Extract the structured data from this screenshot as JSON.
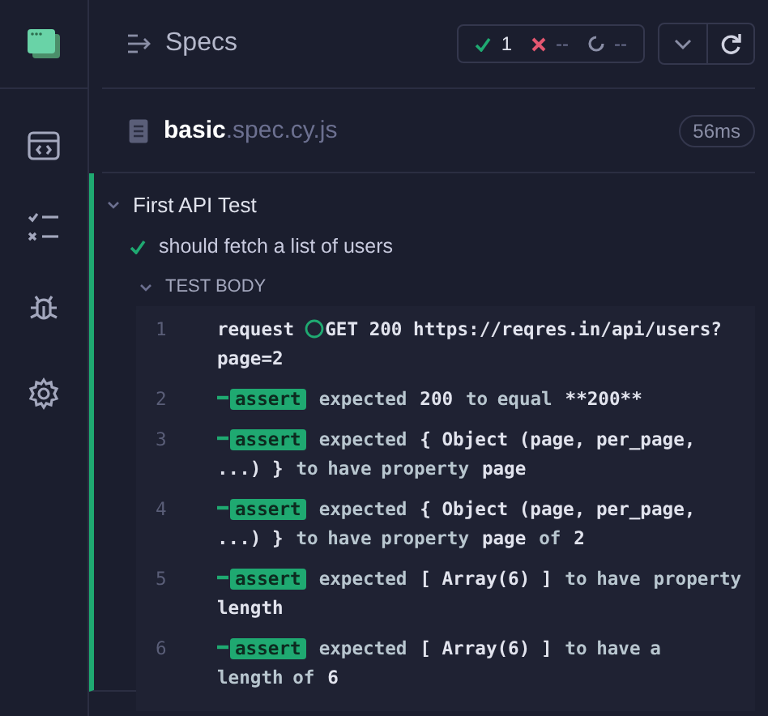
{
  "header": {
    "title": "Specs",
    "stats": [
      {
        "kind": "passed",
        "value": "1"
      },
      {
        "kind": "failed",
        "value": "--"
      },
      {
        "kind": "pending",
        "value": "--"
      }
    ]
  },
  "spec": {
    "name": "basic",
    "extension": ".spec.cy.js",
    "duration": "56ms"
  },
  "suite": {
    "title": "First API Test",
    "expanded": true
  },
  "test": {
    "title": "should fetch a list of users",
    "passed": true
  },
  "test_body": {
    "label": "TEST BODY",
    "expanded": true
  },
  "commands": [
    {
      "number": "1",
      "kind": "request",
      "name": "request",
      "parts": [
        {
          "kind": "value",
          "text": "GET 200 https://reqres.in/api/users?"
        },
        {
          "kind": "value",
          "text": "page=2"
        }
      ]
    },
    {
      "number": "2",
      "kind": "assert",
      "name": "assert",
      "parts": [
        {
          "kind": "plain",
          "text": "expected"
        },
        {
          "kind": "value",
          "text": "200"
        },
        {
          "kind": "plain",
          "text": "to equal"
        },
        {
          "kind": "value",
          "text": "**200**"
        }
      ]
    },
    {
      "number": "3",
      "kind": "assert",
      "name": "assert",
      "parts": [
        {
          "kind": "plain",
          "text": "expected"
        },
        {
          "kind": "value",
          "text": "{ Object (page, per_page,"
        },
        {
          "kind": "value",
          "text": "...) }"
        },
        {
          "kind": "plain",
          "text": "to have property"
        },
        {
          "kind": "value",
          "text": "page"
        }
      ]
    },
    {
      "number": "4",
      "kind": "assert",
      "name": "assert",
      "parts": [
        {
          "kind": "plain",
          "text": "expected"
        },
        {
          "kind": "value",
          "text": "{ Object (page, per_page,"
        },
        {
          "kind": "value",
          "text": "...) }"
        },
        {
          "kind": "plain",
          "text": "to have property"
        },
        {
          "kind": "value",
          "text": "page"
        },
        {
          "kind": "plain",
          "text": "of"
        },
        {
          "kind": "value",
          "text": "2"
        }
      ]
    },
    {
      "number": "5",
      "kind": "assert",
      "name": "assert",
      "parts": [
        {
          "kind": "plain",
          "text": "expected"
        },
        {
          "kind": "value",
          "text": "[ Array(6) ]"
        },
        {
          "kind": "plain",
          "text": "to have"
        },
        {
          "kind": "plain",
          "text": "property"
        },
        {
          "kind": "value",
          "text": "length"
        }
      ]
    },
    {
      "number": "6",
      "kind": "assert",
      "name": "assert",
      "parts": [
        {
          "kind": "plain",
          "text": "expected"
        },
        {
          "kind": "value",
          "text": "[ Array(6) ]"
        },
        {
          "kind": "plain",
          "text": "to have a"
        },
        {
          "kind": "plain",
          "text": "length of"
        },
        {
          "kind": "value",
          "text": "6"
        }
      ]
    }
  ]
}
